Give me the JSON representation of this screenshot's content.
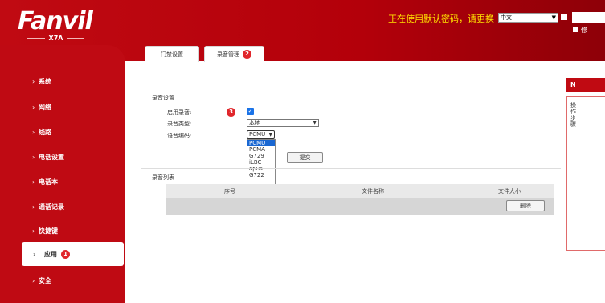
{
  "header": {
    "logo": "Fanvil",
    "model": "X7A",
    "warning": "正在使用默认密码，请更换",
    "language": "中文",
    "right_partial": "修"
  },
  "sidebar": {
    "items": [
      {
        "label": "系统"
      },
      {
        "label": "网络"
      },
      {
        "label": "线路"
      },
      {
        "label": "电话设置"
      },
      {
        "label": "电话本"
      },
      {
        "label": "通话记录"
      },
      {
        "label": "快捷键"
      },
      {
        "label": "应用",
        "badge": "1"
      },
      {
        "label": "安全"
      }
    ]
  },
  "tabs": [
    {
      "label": "门禁设置"
    },
    {
      "label": "录音管理",
      "badge": "2"
    }
  ],
  "recording": {
    "section_title": "录音设置",
    "enable_label": "启用录音:",
    "enable_badge": "3",
    "enabled": true,
    "type_label": "录音类型:",
    "type_value": "本地",
    "codec_label": "语音编码:",
    "codec_value": "PCMU",
    "codec_options": [
      "PCMU",
      "PCMA",
      "G729",
      "iLBC",
      "opus",
      "G722"
    ],
    "submit": "提交"
  },
  "record_list": {
    "title": "录音列表",
    "columns": [
      "序号",
      "文件名称",
      "文件大小"
    ],
    "delete": "删除"
  },
  "right_panel": {
    "head": "N",
    "text": "操作步骤"
  },
  "colors": {
    "brand_red": "#c00a12",
    "badge_red": "#e0262b",
    "selected_blue": "#1967d2",
    "warning_yellow": "#ffe000"
  }
}
